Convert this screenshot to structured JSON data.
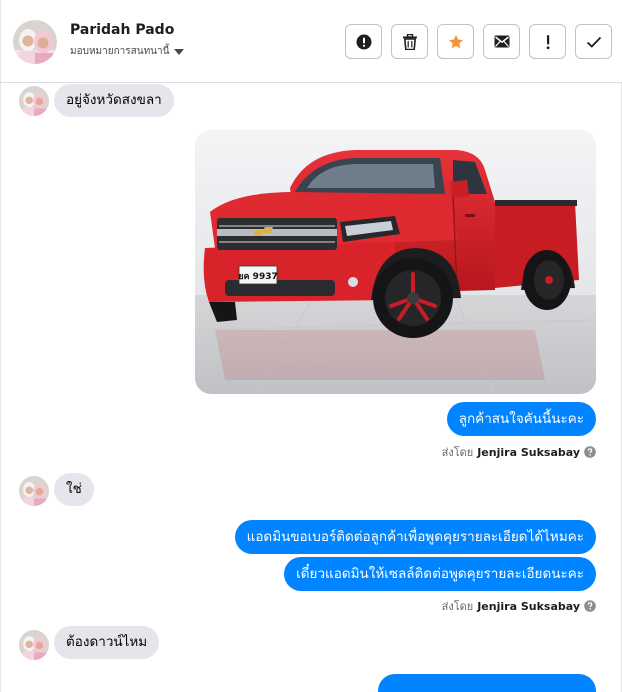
{
  "header": {
    "contact_name": "Paridah Pado",
    "assign_label": "มอบหมายการสนทนานี้",
    "actions": [
      {
        "name": "mark-spam-button",
        "icon": "alert-circle-icon"
      },
      {
        "name": "delete-button",
        "icon": "trash-icon"
      },
      {
        "name": "star-button",
        "icon": "star-icon"
      },
      {
        "name": "mark-unread-button",
        "icon": "envelope-icon"
      },
      {
        "name": "follow-up-button",
        "icon": "exclamation-icon"
      },
      {
        "name": "mark-done-button",
        "icon": "check-icon"
      }
    ]
  },
  "colors": {
    "outgoing_bubble": "#0084ff",
    "incoming_bubble": "#e4e6eb",
    "star_accent": "#f7923a",
    "car_red": "#d8232a"
  },
  "messages": [
    {
      "direction": "in",
      "text": "อยู่จังหวัดสงขลา"
    },
    {
      "direction": "out",
      "type": "image",
      "description_icon": "red-pickup-truck-photo",
      "plate_text": "ยค 9937"
    },
    {
      "direction": "out",
      "text": "ลูกค้าสนใจคันนี้นะคะ"
    },
    {
      "direction": "meta",
      "sent_by_label": "ส่งโดย",
      "agent": "Jenjira Suksabay"
    },
    {
      "direction": "in",
      "text": "ใช่"
    },
    {
      "direction": "out",
      "text": "แอดมินขอเบอร์ติดต่อลูกค้าเพื่อพูดคุยรายละเอียดได้ไหมคะ"
    },
    {
      "direction": "out",
      "text": "เดี๋ยวแอดมินให้เซลล์ติดต่อพูดคุยรายละเอียดนะคะ"
    },
    {
      "direction": "meta",
      "sent_by_label": "ส่งโดย",
      "agent": "Jenjira Suksabay"
    },
    {
      "direction": "in",
      "text": "ต้องดาวน์ไหม"
    }
  ]
}
